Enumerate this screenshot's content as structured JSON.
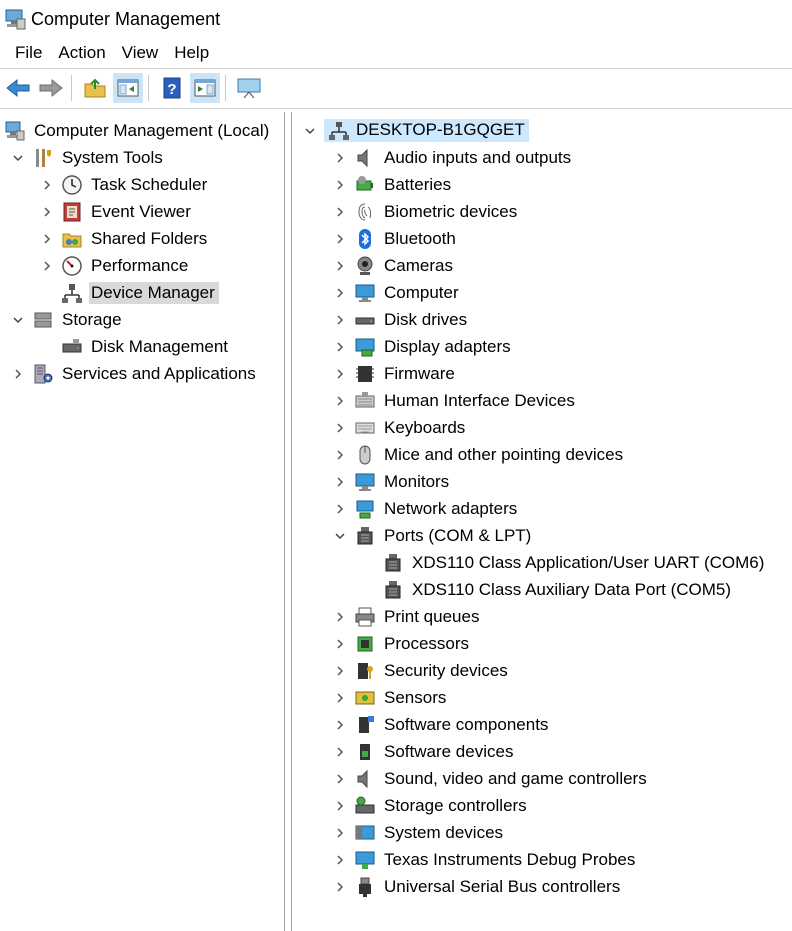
{
  "window": {
    "title": "Computer Management"
  },
  "menu": [
    "File",
    "Action",
    "View",
    "Help"
  ],
  "toolbar": {
    "buttons": [
      "back-arrow-icon",
      "forward-arrow-icon",
      "up-folder-icon",
      "show-hide-console-tree-icon",
      "help-icon",
      "show-hide-action-pane-icon",
      "monitor-icon"
    ]
  },
  "left_tree": {
    "root": "Computer Management (Local)",
    "system_tools": "System Tools",
    "task_scheduler": "Task Scheduler",
    "event_viewer": "Event Viewer",
    "shared_folders": "Shared Folders",
    "performance": "Performance",
    "device_manager": "Device Manager",
    "storage": "Storage",
    "disk_management": "Disk Management",
    "services": "Services and Applications"
  },
  "devices": {
    "root": "DESKTOP-B1GQGET",
    "categories": [
      "Audio inputs and outputs",
      "Batteries",
      "Biometric devices",
      "Bluetooth",
      "Cameras",
      "Computer",
      "Disk drives",
      "Display adapters",
      "Firmware",
      "Human Interface Devices",
      "Keyboards",
      "Mice and other pointing devices",
      "Monitors",
      "Network adapters",
      "Ports (COM & LPT)",
      "Print queues",
      "Processors",
      "Security devices",
      "Sensors",
      "Software components",
      "Software devices",
      "Sound, video and game controllers",
      "Storage controllers",
      "System devices",
      "Texas Instruments Debug Probes",
      "Universal Serial Bus controllers"
    ],
    "ports_children": [
      "XDS110 Class Application/User UART (COM6)",
      "XDS110 Class Auxiliary Data Port (COM5)"
    ]
  }
}
